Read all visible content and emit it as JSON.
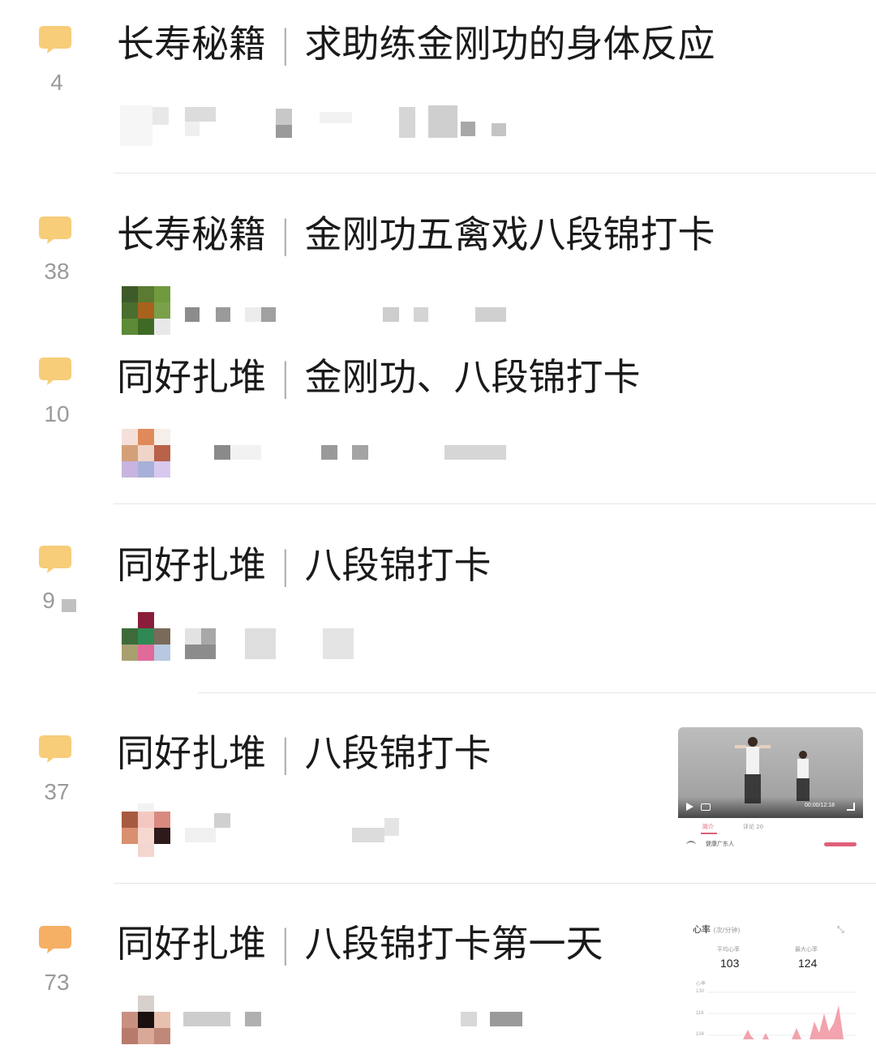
{
  "posts": [
    {
      "category": "长寿秘籍",
      "separator": "|",
      "title": "求助练金刚功的身体反应",
      "comment_count": "4"
    },
    {
      "category": "长寿秘籍",
      "separator": "|",
      "title": "金刚功五禽戏八段锦打卡",
      "comment_count": "38"
    },
    {
      "category": "同好扎堆",
      "separator": "|",
      "title": "金刚功、八段锦打卡",
      "comment_count": "10"
    },
    {
      "category": "同好扎堆",
      "separator": "|",
      "title": "八段锦打卡",
      "comment_count": "9"
    },
    {
      "category": "同好扎堆",
      "separator": "|",
      "title": "八段锦打卡",
      "comment_count": "37"
    },
    {
      "category": "同好扎堆",
      "separator": "|",
      "title": "八段锦打卡第一天",
      "comment_count": "73"
    }
  ],
  "thumb_heart_rate": {
    "title": "心率",
    "unit": "(次/分钟)",
    "avg_label": "平均心率",
    "avg_value": "103",
    "max_label": "最大心率",
    "max_value": "124",
    "axis_label": "心率",
    "axis_ticks": [
      "130",
      "116",
      "104"
    ]
  },
  "thumb_video": {
    "time": "00:00/12:18",
    "tab_1": "简介",
    "tab_2": "评论 20",
    "author": "健康广东人"
  },
  "colors": {
    "bubble": "#f7cd7a",
    "bubble_last": "#f5b066",
    "count": "#9a9a9a",
    "title": "#1a1a1a",
    "divider": "#e6e6e6",
    "chart_fill": "#f2a3ad"
  }
}
